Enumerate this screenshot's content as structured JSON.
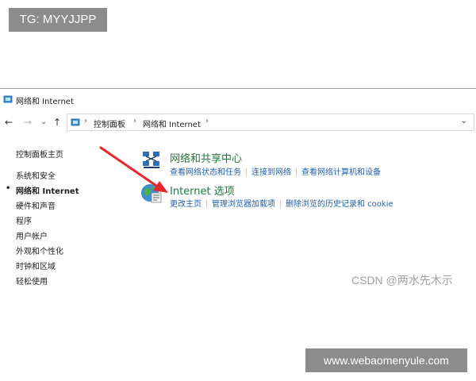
{
  "overlay": {
    "tg_badge": "TG: MYYJJPP",
    "csdn_watermark": "CSDN @两水先木示",
    "site_watermark": "www.webaomenyule.com",
    "arrow_color": "#e8262d"
  },
  "window": {
    "title": "网络和 Internet"
  },
  "navigation": {
    "back_icon": "arrow-left-icon",
    "forward_icon": "arrow-right-icon",
    "recent_icon": "chevron-down-icon",
    "up_icon": "arrow-up-icon",
    "breadcrumbs": [
      "控制面板",
      "网络和 Internet"
    ],
    "separator": "›",
    "dropdown_icon": "chevron-down-icon"
  },
  "sidebar": {
    "items": [
      {
        "label": "控制面板主页",
        "active": false
      },
      {
        "label": "系统和安全",
        "active": false
      },
      {
        "label": "网络和 Internet",
        "active": true
      },
      {
        "label": "硬件和声音",
        "active": false
      },
      {
        "label": "程序",
        "active": false
      },
      {
        "label": "用户帐户",
        "active": false
      },
      {
        "label": "外观和个性化",
        "active": false
      },
      {
        "label": "时钟和区域",
        "active": false
      },
      {
        "label": "轻松使用",
        "active": false
      }
    ],
    "bullet": "•"
  },
  "categories": [
    {
      "title": "网络和共享中心",
      "icon": "network-sharing-center-icon",
      "links": [
        "查看网络状态和任务",
        "连接到网络",
        "查看网络计算机和设备"
      ]
    },
    {
      "title": "Internet 选项",
      "icon": "internet-options-globe-icon",
      "links": [
        "更改主页",
        "管理浏览器加载项",
        "删除浏览的历史记录和 cookie"
      ]
    }
  ],
  "colors": {
    "category_title": "#1f7a3a",
    "link": "#1f5fae"
  }
}
